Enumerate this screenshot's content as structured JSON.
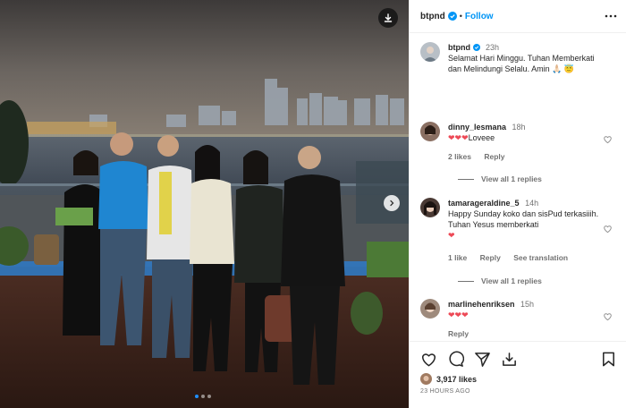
{
  "header": {
    "username": "btpnd",
    "separator": "•",
    "follow_label": "Follow",
    "verified_icon": "verified-badge-icon",
    "more_icon": "more-options-icon"
  },
  "photo": {
    "download_icon": "download-icon",
    "next_icon": "chevron-right-icon",
    "slide_count": 3,
    "active_slide": 1
  },
  "caption": {
    "username": "btpnd",
    "time": "23h",
    "text": "Selamat Hari Minggu. Tuhan Memberkati dan Melindungi Selalu. Amin 🙏🏻 😇"
  },
  "comments": [
    {
      "username": "dinny_lesmana",
      "time": "18h",
      "text": "❤️❤️❤️Loveee",
      "hearts": "❤❤❤",
      "after": "Loveee",
      "likes": "2 likes",
      "reply": "Reply",
      "translation": "",
      "view_replies": "View all 1 replies"
    },
    {
      "username": "tamarageraldine_5",
      "time": "14h",
      "text": "Happy Sunday koko dan sisPud terkasiiih. Tuhan Yesus memberkati",
      "hearts": "❤",
      "after": "",
      "likes": "1 like",
      "reply": "Reply",
      "translation": "See translation",
      "view_replies": "View all 1 replies"
    },
    {
      "username": "marlinehenriksen",
      "time": "15h",
      "text": "",
      "hearts": "❤❤❤",
      "after": "",
      "likes": "",
      "reply": "Reply",
      "translation": "",
      "view_replies": ""
    }
  ],
  "footer": {
    "likes": "3,917 likes",
    "time_ago": "23 HOURS AGO",
    "icons": [
      "heart-icon",
      "comment-icon",
      "share-icon",
      "save-icon"
    ]
  },
  "colors": {
    "accent": "#0095f6",
    "verified": "#0095f6",
    "heart": "#ed4956",
    "muted": "#737373"
  }
}
